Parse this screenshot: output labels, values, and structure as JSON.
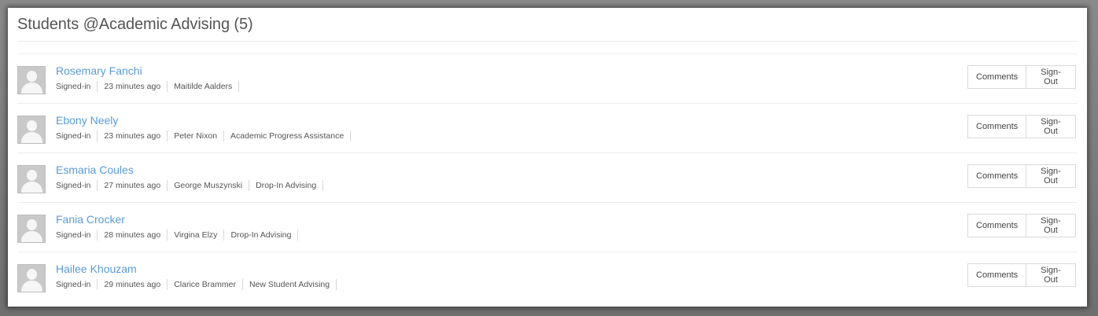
{
  "panel": {
    "title": "Students @Academic Advising (5)"
  },
  "students": [
    {
      "name": "Rosemary Fanchi",
      "meta": [
        "Signed-in",
        "23 minutes ago",
        "Maitilde Aalders"
      ],
      "comments_label": "Comments",
      "signout_label": "Sign-Out"
    },
    {
      "name": "Ebony Neely",
      "meta": [
        "Signed-in",
        "23 minutes ago",
        "Peter Nixon",
        "Academic Progress Assistance"
      ],
      "comments_label": "Comments",
      "signout_label": "Sign-Out"
    },
    {
      "name": "Esmaria Coules",
      "meta": [
        "Signed-in",
        "27 minutes ago",
        "George Muszynski",
        "Drop-In Advising"
      ],
      "comments_label": "Comments",
      "signout_label": "Sign-Out"
    },
    {
      "name": "Fania Crocker",
      "meta": [
        "Signed-in",
        "28 minutes ago",
        "Virgina Elzy",
        "Drop-In Advising"
      ],
      "comments_label": "Comments",
      "signout_label": "Sign-Out"
    },
    {
      "name": "Hailee Khouzam",
      "meta": [
        "Signed-in",
        "29 minutes ago",
        "Clarice Brammer",
        "New Student Advising"
      ],
      "comments_label": "Comments",
      "signout_label": "Sign-Out"
    }
  ],
  "icons": {
    "avatar": "default-user-avatar-icon"
  },
  "colors": {
    "name_link": "#5b9bd8",
    "title_text": "#555555",
    "frame": "#7d7d7d"
  }
}
